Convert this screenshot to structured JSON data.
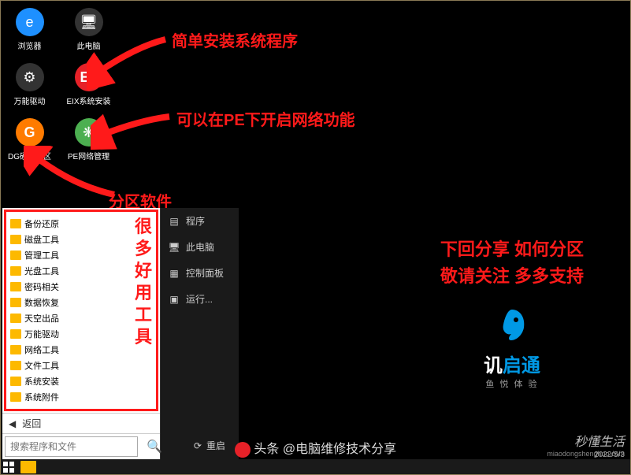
{
  "desktop": {
    "icons": [
      {
        "label": "浏览器",
        "name": "browser-icon",
        "cls": "ic-ie",
        "glyph": "e"
      },
      {
        "label": "此电脑",
        "name": "this-pc-icon",
        "cls": "ic-pc",
        "glyph": "🖥"
      },
      {
        "label": "万能驱动",
        "name": "driver-icon",
        "cls": "ic-gear",
        "glyph": "⚙"
      },
      {
        "label": "EIX系统安装",
        "name": "eix-install-icon",
        "cls": "ic-eix",
        "glyph": "EII"
      },
      {
        "label": "DG硬盘分区",
        "name": "dg-partition-icon",
        "cls": "ic-dg",
        "glyph": "G"
      },
      {
        "label": "PE网络管理",
        "name": "pe-network-icon",
        "cls": "ic-net",
        "glyph": "❋"
      }
    ]
  },
  "annotations": {
    "a1": "简单安装系统程序",
    "a2": "可以在PE下开启网络功能",
    "a3": "分区软件",
    "a4": "很\n多\n好\n用\n工\n具"
  },
  "startmenu": {
    "categories": [
      "备份还原",
      "磁盘工具",
      "管理工具",
      "光盘工具",
      "密码相关",
      "数据恢复",
      "天空出品",
      "万能驱动",
      "网络工具",
      "文件工具",
      "系统安装",
      "系统附件"
    ],
    "right_items": [
      {
        "label": "程序",
        "icon": "▤"
      },
      {
        "label": "此电脑",
        "icon": "🖥"
      },
      {
        "label": "控制面板",
        "icon": "▦"
      },
      {
        "label": "运行...",
        "icon": "▣"
      }
    ],
    "back": "返回",
    "search_placeholder": "搜索程序和文件",
    "restart": "重启"
  },
  "promo": {
    "line1": "下回分享  如何分区",
    "line2": "敬请关注  多多支持",
    "brand_pre": "讥",
    "brand_accent": "启通",
    "brand_sub": "鱼 悦 体 验"
  },
  "attribution": {
    "text": "头条 @电脑维修技术分享"
  },
  "watermark": {
    "line1": "秒懂生活",
    "line2": "miaodongshenghuo.com",
    "date": "2022/5/3"
  }
}
